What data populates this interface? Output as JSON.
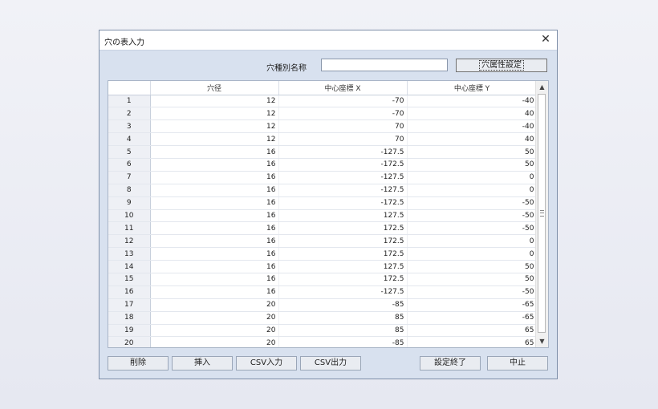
{
  "dialog": {
    "title": "穴の表入力",
    "close_glyph": "✕"
  },
  "hole_name": {
    "label": "穴種別名称",
    "value": "",
    "attr_button": "穴属性設定"
  },
  "grid": {
    "columns": [
      "穴径",
      "中心座標 X",
      "中心座標 Y"
    ],
    "rows": [
      [
        "1",
        "12",
        "-70",
        "-40"
      ],
      [
        "2",
        "12",
        "-70",
        "40"
      ],
      [
        "3",
        "12",
        "70",
        "-40"
      ],
      [
        "4",
        "12",
        "70",
        "40"
      ],
      [
        "5",
        "16",
        "-127.5",
        "50"
      ],
      [
        "6",
        "16",
        "-172.5",
        "50"
      ],
      [
        "7",
        "16",
        "-127.5",
        "0"
      ],
      [
        "8",
        "16",
        "-127.5",
        "0"
      ],
      [
        "9",
        "16",
        "-172.5",
        "-50"
      ],
      [
        "10",
        "16",
        "127.5",
        "-50"
      ],
      [
        "11",
        "16",
        "172.5",
        "-50"
      ],
      [
        "12",
        "16",
        "172.5",
        "0"
      ],
      [
        "13",
        "16",
        "172.5",
        "0"
      ],
      [
        "14",
        "16",
        "127.5",
        "50"
      ],
      [
        "15",
        "16",
        "172.5",
        "50"
      ],
      [
        "16",
        "16",
        "-127.5",
        "-50"
      ],
      [
        "17",
        "20",
        "-85",
        "-65"
      ],
      [
        "18",
        "20",
        "85",
        "-65"
      ],
      [
        "19",
        "20",
        "85",
        "65"
      ],
      [
        "20",
        "20",
        "-85",
        "65"
      ]
    ]
  },
  "buttons": {
    "delete": "削除",
    "insert": "挿入",
    "csv_in": "CSV入力",
    "csv_out": "CSV出力",
    "finish": "設定終了",
    "cancel": "中止"
  }
}
